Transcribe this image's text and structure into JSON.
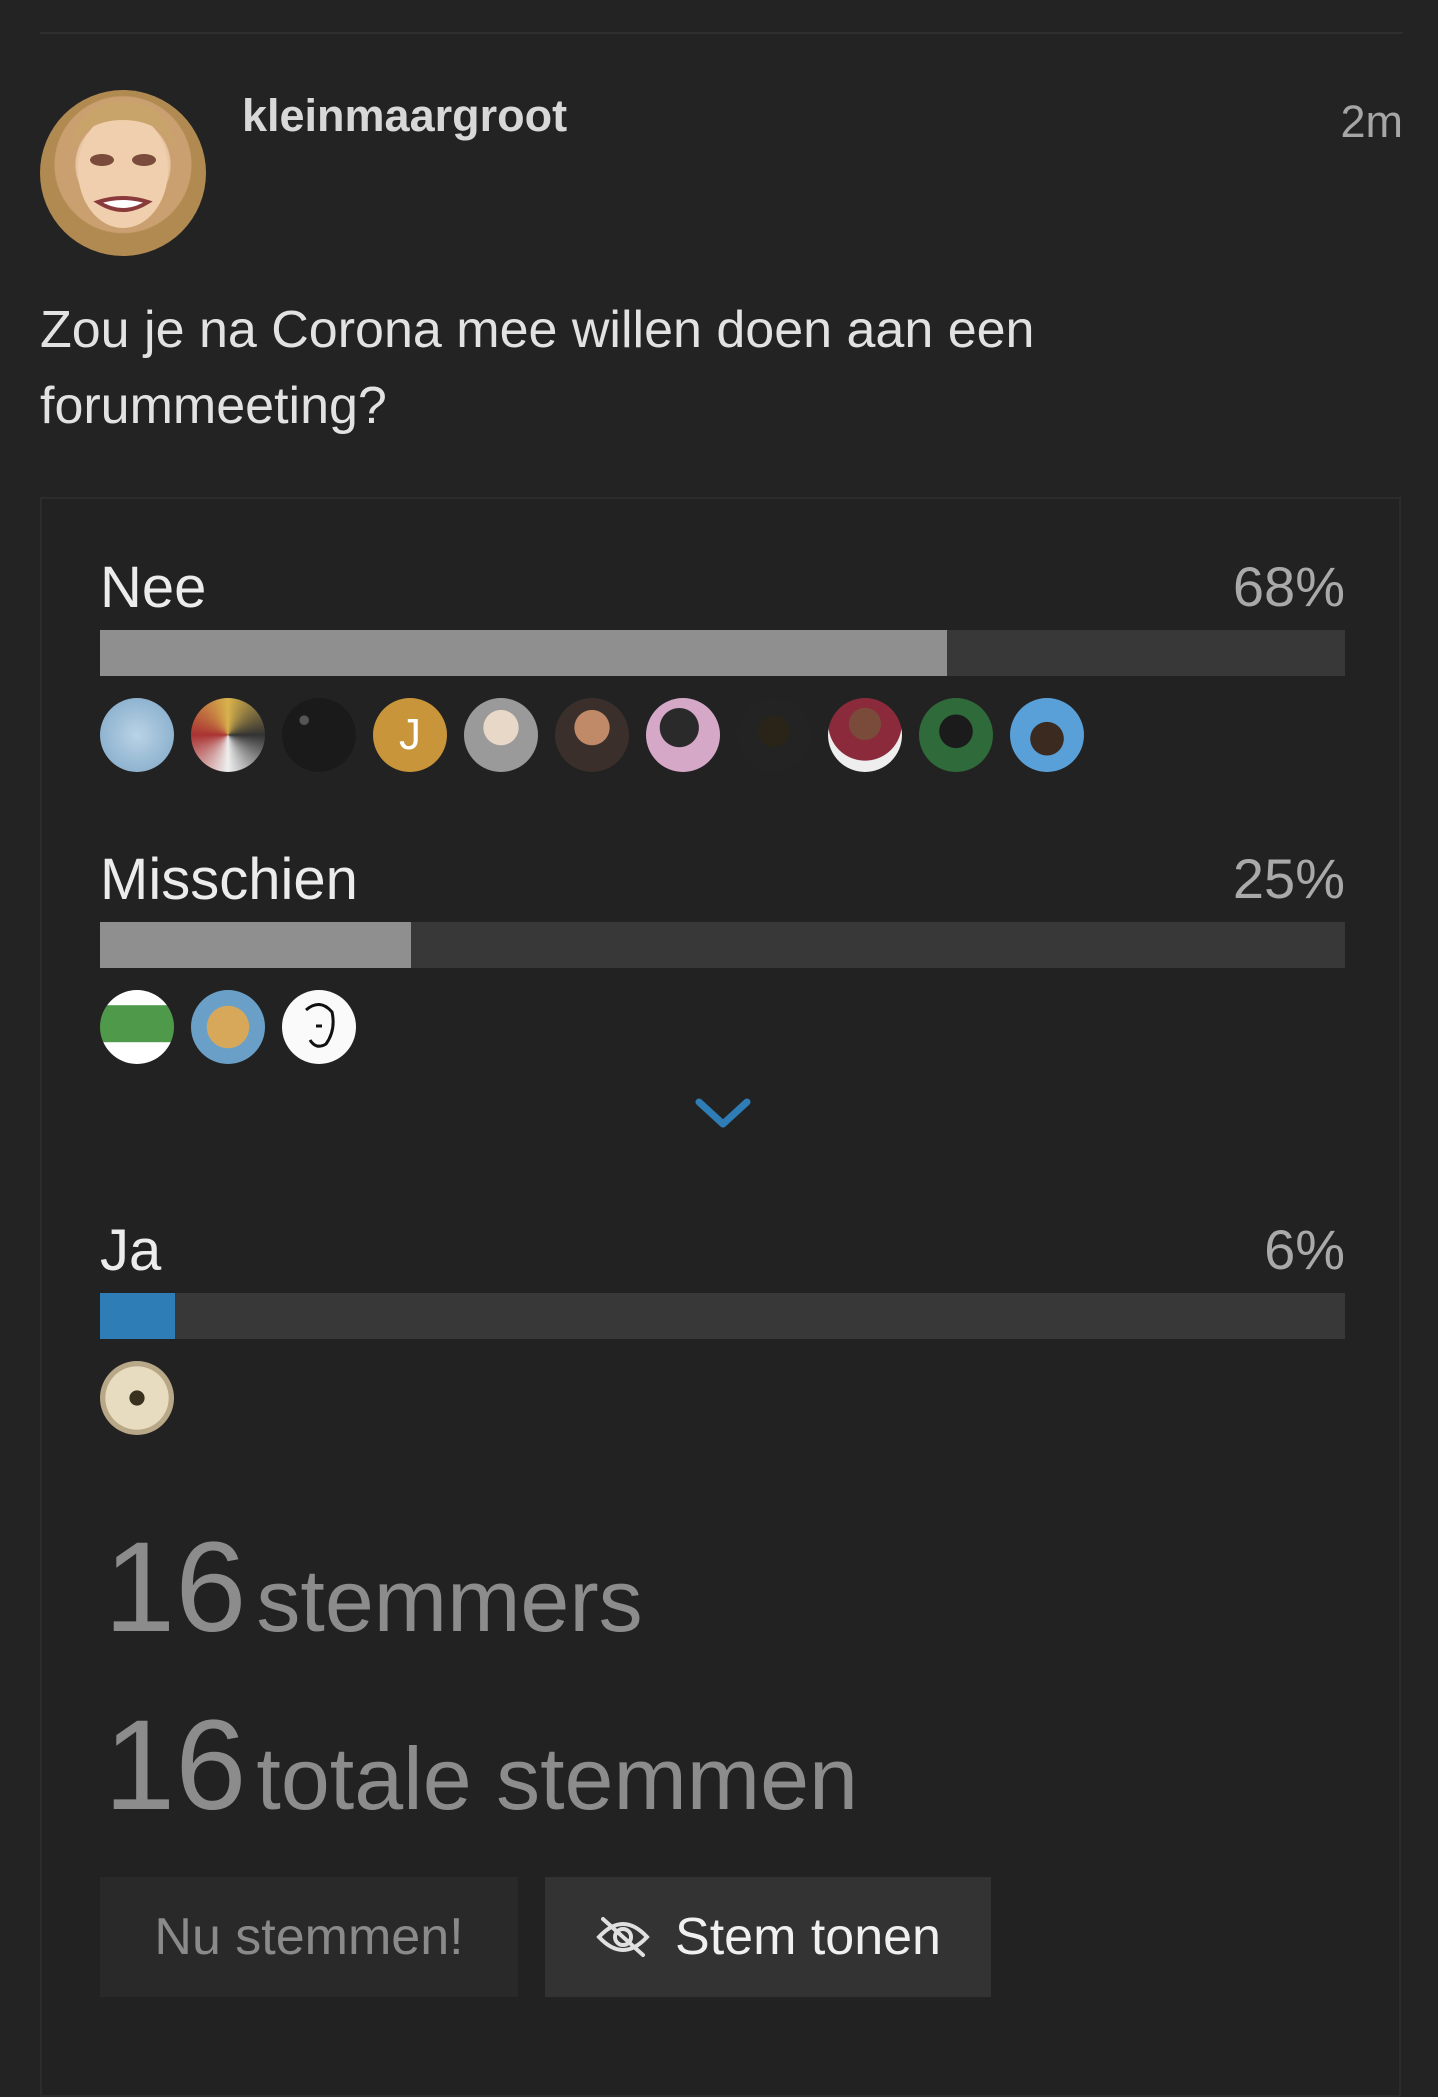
{
  "post": {
    "username": "kleinmaargroot",
    "timestamp": "2m",
    "question": "Zou je na Corona mee willen doen aan een forummeeting?"
  },
  "poll": {
    "options": [
      {
        "label": "Nee",
        "percent_text": "68%",
        "percent": 68,
        "selected": false,
        "voter_count_shown": 11,
        "letter_avatar": "J"
      },
      {
        "label": "Misschien",
        "percent_text": "25%",
        "percent": 25,
        "selected": false,
        "voter_count_shown": 3
      },
      {
        "label": "Ja",
        "percent_text": "6%",
        "percent": 6,
        "selected": true,
        "voter_count_shown": 1
      }
    ],
    "voters_count": "16",
    "voters_label": "stemmers",
    "votes_count": "16",
    "votes_label": "totale stemmen",
    "vote_button": "Nu stemmen!",
    "show_button": "Stem tonen"
  },
  "colors": {
    "background": "#232323",
    "bar_track": "#383838",
    "bar_fill": "#8f8f8f",
    "bar_selected": "#2f7db6",
    "accent": "#2f7db6"
  },
  "icons": {
    "expand": "chevron-down-icon",
    "show": "eye-off-icon"
  }
}
